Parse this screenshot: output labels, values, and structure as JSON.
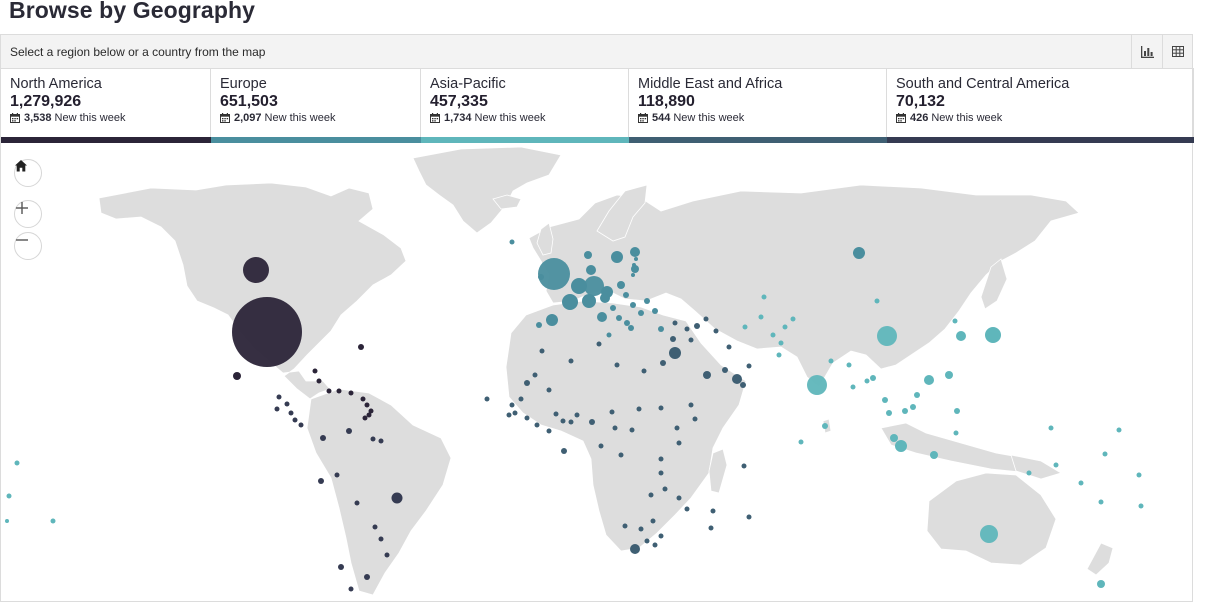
{
  "page": {
    "title": "Browse by Geography"
  },
  "toolbar": {
    "instruction": "Select a region below or a country from the map",
    "chart_icon": "bar-chart-icon",
    "table_icon": "table-icon"
  },
  "regions": [
    {
      "name": "North America",
      "value": "1,279,926",
      "new_count": "3,538",
      "new_label": "New this week",
      "color": "#2b2438"
    },
    {
      "name": "Europe",
      "value": "651,503",
      "new_count": "2,097",
      "new_label": "New this week",
      "color": "#4a8e9e"
    },
    {
      "name": "Asia-Pacific",
      "value": "457,335",
      "new_count": "1,734",
      "new_label": "New this week",
      "color": "#5fb6bb"
    },
    {
      "name": "Middle East and Africa",
      "value": "118,890",
      "new_count": "544",
      "new_label": "New this week",
      "color": "#3f5f73"
    },
    {
      "name": "South and Central America",
      "value": "70,132",
      "new_count": "426",
      "new_label": "New this week",
      "color": "#353b52"
    }
  ],
  "map_controls": {
    "home_icon": "home-icon",
    "zoom_in_icon": "plus-icon",
    "zoom_out_icon": "minus-icon"
  },
  "map_colors": {
    "land": "#dddddd",
    "north_america": "#2b2438",
    "europe": "#4a8e9e",
    "asia_pacific": "#5fb6bb",
    "mea": "#3f5f73",
    "south_america": "#353b52"
  }
}
